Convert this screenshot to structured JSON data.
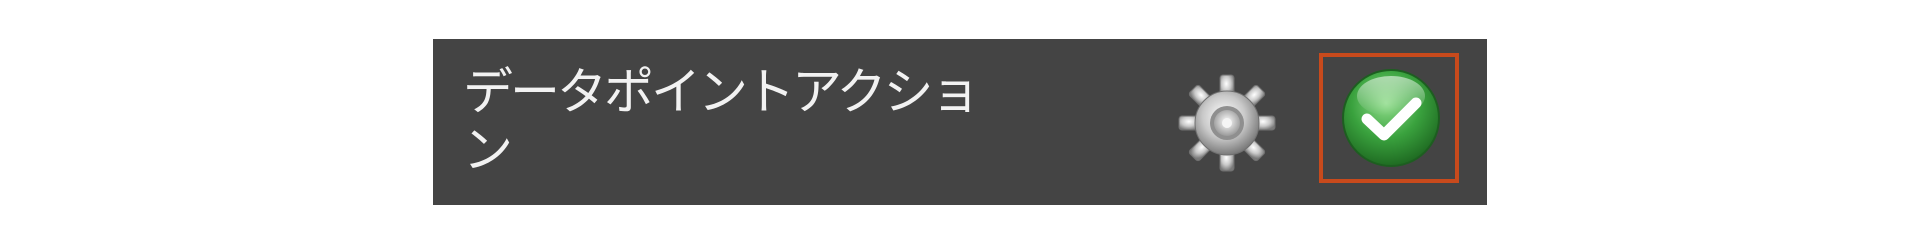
{
  "header": {
    "title": "データポイントアクション"
  },
  "icons": {
    "settings": "gear-icon",
    "confirm": "checkmark-icon"
  },
  "colors": {
    "panel_background": "#444444",
    "title_text": "#f2f2f2",
    "confirm_green": "#3aa23e",
    "highlight_border": "#c84a1c"
  }
}
